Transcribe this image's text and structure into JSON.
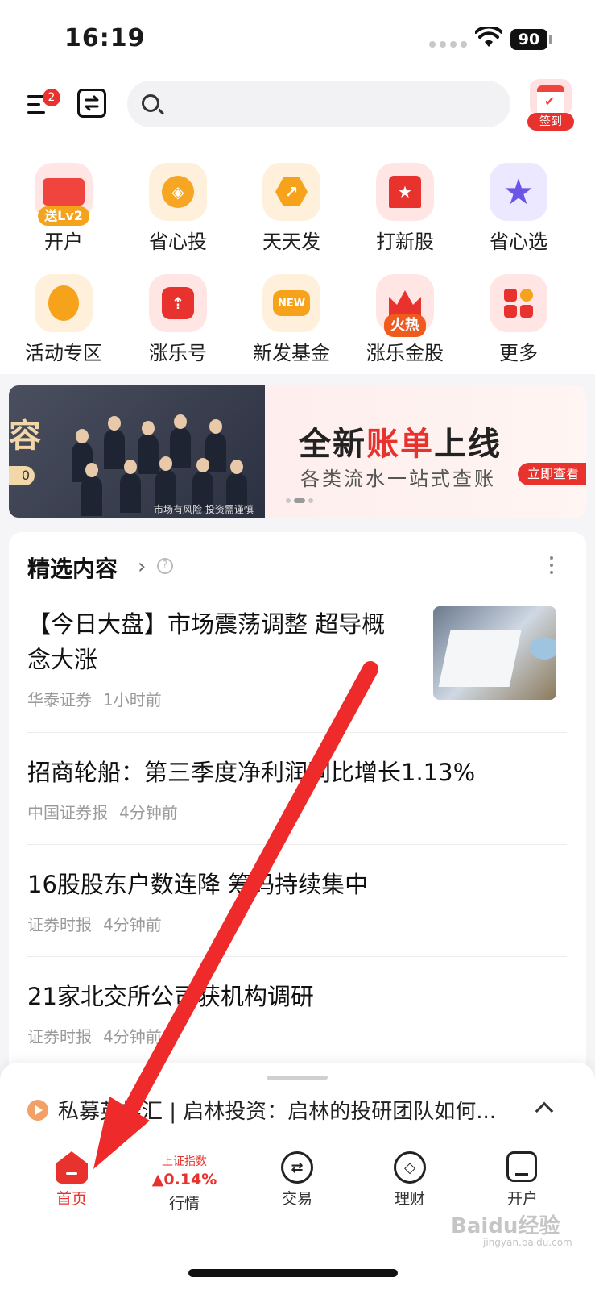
{
  "status": {
    "time": "16:19",
    "battery": "90"
  },
  "header": {
    "menu_badge": "2",
    "search_placeholder": "",
    "checkin_label": "签到"
  },
  "grid": {
    "items": [
      {
        "label": "开户",
        "badge": "送Lv2",
        "icon": "account-card-icon"
      },
      {
        "label": "省心投",
        "icon": "coins-icon"
      },
      {
        "label": "天天发",
        "icon": "trend-hexagon-icon"
      },
      {
        "label": "打新股",
        "icon": "star-ribbon-icon"
      },
      {
        "label": "省心选",
        "icon": "star-check-icon"
      },
      {
        "label": "活动专区",
        "icon": "balloon-icon"
      },
      {
        "label": "涨乐号",
        "icon": "arrow-up-box-icon"
      },
      {
        "label": "新发基金",
        "new_tag": "NEW",
        "icon": "new-fund-icon"
      },
      {
        "label": "涨乐金股",
        "badge": "火热",
        "icon": "crown-icon"
      },
      {
        "label": "更多",
        "icon": "grid-more-icon"
      }
    ]
  },
  "banner": {
    "left_text": "容",
    "left_pill": "0",
    "risk_note": "市场有风险 投资需谨慎",
    "title_a": "全新",
    "title_highlight": "账单",
    "title_b": "上线",
    "subtitle": "各类流水一站式查账",
    "cta": "立即查看"
  },
  "feed": {
    "section_title": "精选内容",
    "items": [
      {
        "title": "【今日大盘】市场震荡调整 超导概念大涨",
        "source": "华泰证券",
        "time": "1小时前"
      },
      {
        "title": "招商轮船：第三季度净利润同比增长1.13%",
        "source": "中国证券报",
        "time": "4分钟前"
      },
      {
        "title": "16股股东户数连降 筹码持续集中",
        "source": "证券时报",
        "time": "4分钟前"
      },
      {
        "title": "21家北交所公司获机构调研",
        "source": "证券时报",
        "time": "4分钟前"
      }
    ]
  },
  "ticker": {
    "text": "私募英雄汇 | 启林投资：启林的投研团队如何..."
  },
  "tabbar": {
    "tabs": [
      {
        "label": "首页"
      },
      {
        "label": "行情"
      },
      {
        "label": "交易"
      },
      {
        "label": "理财"
      },
      {
        "label": "开户"
      }
    ],
    "index_name": "上证指数",
    "index_value": "▲0.14%"
  },
  "watermark": {
    "brand": "Baidu经验",
    "url": "jingyan.baidu.com"
  },
  "colors": {
    "accent": "#e8322e",
    "arrow": "#ee2a2a"
  }
}
